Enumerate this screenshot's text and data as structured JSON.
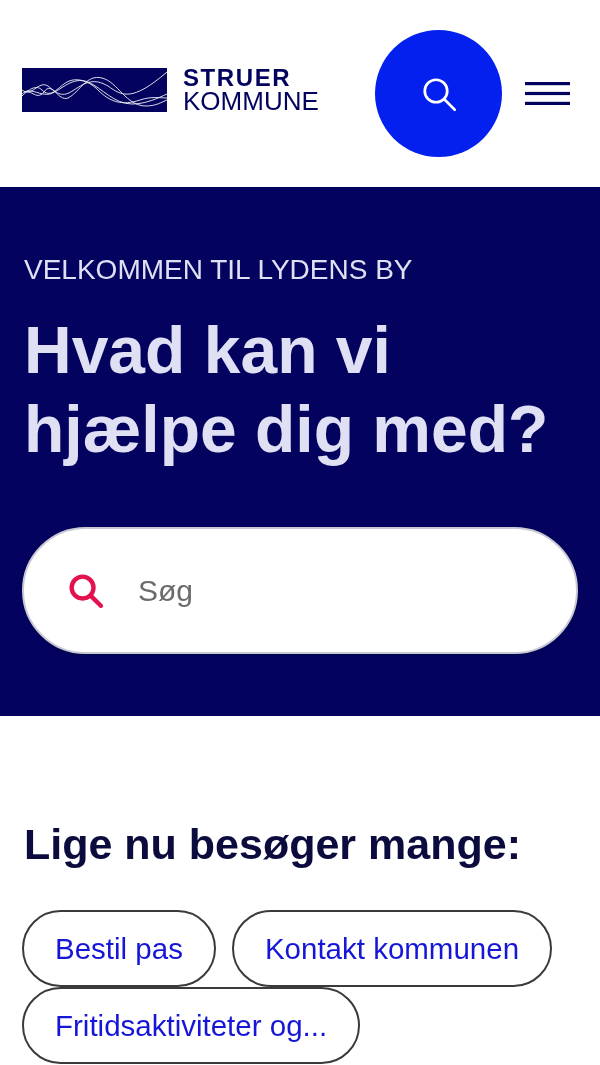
{
  "header": {
    "logo": {
      "line_1": "STRUER",
      "line_2": "KOMMUNE"
    }
  },
  "hero": {
    "eyebrow": "VELKOMMEN TIL LYDENS BY",
    "title": "Hvad kan vi hjælpe dig med?",
    "search": {
      "placeholder": "Søg"
    }
  },
  "popular": {
    "title": "Lige nu besøger mange:",
    "links": [
      "Bestil pas",
      "Kontakt kommunen",
      "Fritidsaktiviteter og..."
    ]
  }
}
